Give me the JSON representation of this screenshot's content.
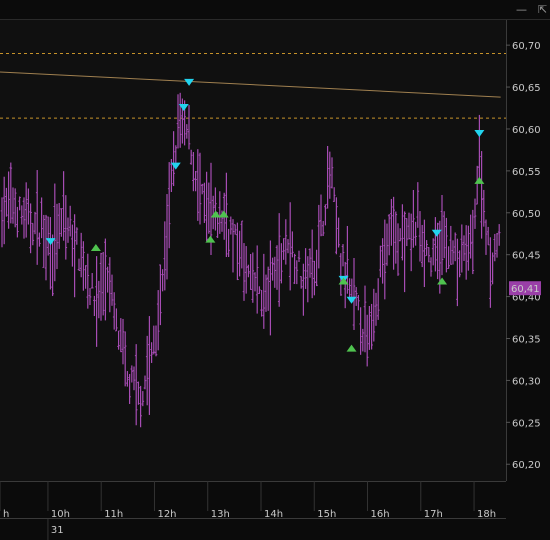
{
  "window": {
    "minimize_glyph": "—",
    "restore_glyph": "⇱"
  },
  "colors": {
    "background": "#0b0b0b",
    "plot_background": "#101010",
    "bars": "#a64cb4",
    "level_lines": "#c6922a",
    "trend_line": "#a08050",
    "marker_down": "#22d3ee",
    "marker_up": "#4fc34f",
    "price_tag_bg": "#9a3fa8",
    "axis_text": "#c9c9c9"
  },
  "chart_data": {
    "type": "ohlc",
    "title": "",
    "xlabel": "",
    "ylabel": "",
    "x_range_hours": [
      9.1,
      18.6
    ],
    "ylim": [
      60.18,
      60.73
    ],
    "y_ticks": [
      "60,70",
      "60,65",
      "60,60",
      "60,55",
      "60,50",
      "60,45",
      "60,40",
      "60,35",
      "60,30",
      "60,25",
      "60,20"
    ],
    "y_tick_values": [
      60.7,
      60.65,
      60.6,
      60.55,
      60.5,
      60.45,
      60.4,
      60.35,
      60.3,
      60.25,
      60.2
    ],
    "x_ticks": [
      "h",
      "10h",
      "11h",
      "12h",
      "13h",
      "14h",
      "15h",
      "16h",
      "17h",
      "18h"
    ],
    "x_tick_values": [
      9.1,
      10.0,
      11.0,
      12.0,
      13.0,
      14.0,
      15.0,
      16.0,
      17.0,
      18.0
    ],
    "date_label": "31",
    "date_label_at": 10.0,
    "last_price_label": "60,41",
    "last_price": 60.41,
    "horizontal_levels": [
      60.69,
      60.613
    ],
    "trend_line": [
      [
        9.1,
        60.668
      ],
      [
        18.5,
        60.638
      ]
    ],
    "series": [
      {
        "profile": [
          [
            9.1,
            60.5
          ],
          [
            9.3,
            60.51
          ],
          [
            9.6,
            60.49
          ],
          [
            9.9,
            60.48
          ],
          [
            10.1,
            60.46
          ],
          [
            10.3,
            60.49
          ],
          [
            10.6,
            60.45
          ],
          [
            10.9,
            60.39
          ],
          [
            11.1,
            60.43
          ],
          [
            11.3,
            60.36
          ],
          [
            11.5,
            60.3
          ],
          [
            11.75,
            60.28
          ],
          [
            11.95,
            60.33
          ],
          [
            12.1,
            60.38
          ],
          [
            12.3,
            60.52
          ],
          [
            12.45,
            60.61
          ],
          [
            12.65,
            60.59
          ],
          [
            12.85,
            60.52
          ],
          [
            13.1,
            60.49
          ],
          [
            13.3,
            60.5
          ],
          [
            13.55,
            60.46
          ],
          [
            13.8,
            60.42
          ],
          [
            14.1,
            60.4
          ],
          [
            14.5,
            60.47
          ],
          [
            14.8,
            60.42
          ],
          [
            15.05,
            60.45
          ],
          [
            15.3,
            60.55
          ],
          [
            15.5,
            60.44
          ],
          [
            15.7,
            60.4
          ],
          [
            15.85,
            60.38
          ],
          [
            16.0,
            60.34
          ],
          [
            16.2,
            60.42
          ],
          [
            16.45,
            60.48
          ],
          [
            16.7,
            60.46
          ],
          [
            16.95,
            60.49
          ],
          [
            17.2,
            60.44
          ],
          [
            17.45,
            60.47
          ],
          [
            17.7,
            60.44
          ],
          [
            17.95,
            60.46
          ],
          [
            18.1,
            60.56
          ],
          [
            18.3,
            60.44
          ],
          [
            18.45,
            60.47
          ],
          [
            18.55,
            60.42
          ]
        ]
      }
    ],
    "markers_down": [
      [
        10.05,
        60.465
      ],
      [
        12.4,
        60.555
      ],
      [
        12.55,
        60.625
      ],
      [
        12.65,
        60.655
      ],
      [
        15.55,
        60.42
      ],
      [
        15.7,
        60.395
      ],
      [
        17.3,
        60.475
      ],
      [
        18.1,
        60.594
      ]
    ],
    "markers_up": [
      [
        10.9,
        60.458
      ],
      [
        13.05,
        60.468
      ],
      [
        13.15,
        60.498
      ],
      [
        13.3,
        60.498
      ],
      [
        15.55,
        60.418
      ],
      [
        15.7,
        60.338
      ],
      [
        17.4,
        60.418
      ],
      [
        18.1,
        60.538
      ]
    ]
  }
}
